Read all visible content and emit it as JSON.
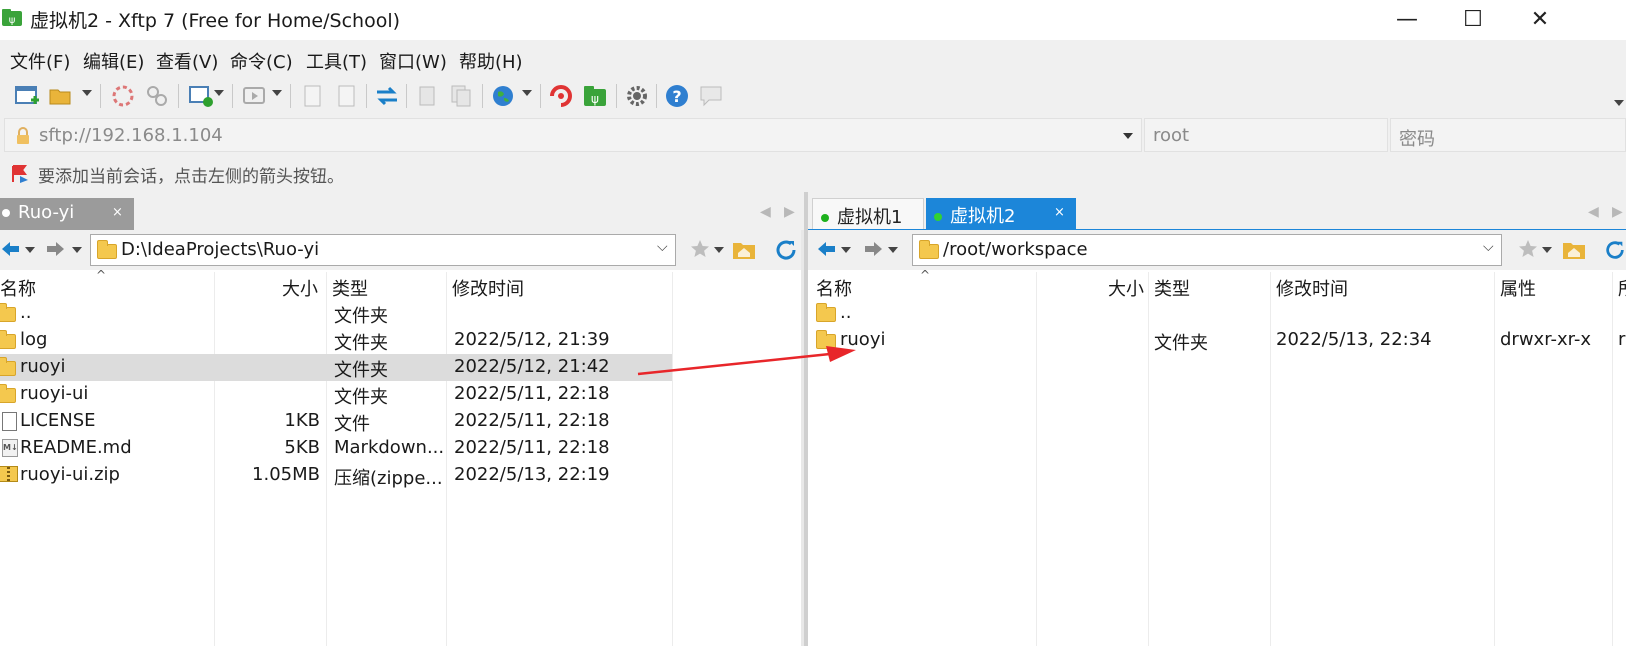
{
  "window": {
    "title": "虚拟机2 - Xftp 7 (Free for Home/School)",
    "minimize": "—",
    "maximize": "☐",
    "close": "✕"
  },
  "menu": [
    "文件(F)",
    "编辑(E)",
    "查看(V)",
    "命令(C)",
    "工具(T)",
    "窗口(W)",
    "帮助(H)"
  ],
  "toolbar": {
    "icons": [
      "new-session-icon",
      "open-folder-icon",
      "disconnect-icon",
      "link-icon",
      "new-window-icon",
      "play-icon",
      "copy-file-icon",
      "paste-file-icon",
      "transfer-icon",
      "copy-icon",
      "duplicate-icon",
      "globe-icon",
      "xshell-icon",
      "xftp-icon",
      "settings-icon",
      "help-icon",
      "chat-icon"
    ]
  },
  "address": {
    "url": "sftp://192.168.1.104",
    "user": "root",
    "password_placeholder": "密码"
  },
  "hint": "要添加当前会话，点击左侧的箭头按钮。",
  "left": {
    "tab": "Ruo-yi",
    "tab_close": "×",
    "path": "D:\\IdeaProjects\\Ruo-yi",
    "columns": [
      "名称",
      "大小",
      "类型",
      "修改时间"
    ],
    "rows": [
      {
        "name": "..",
        "size": "",
        "type": "文件夹",
        "modified": "",
        "icon": "folder-icon"
      },
      {
        "name": "log",
        "size": "",
        "type": "文件夹",
        "modified": "2022/5/12, 21:39",
        "icon": "folder-icon"
      },
      {
        "name": "ruoyi",
        "size": "",
        "type": "文件夹",
        "modified": "2022/5/12, 21:42",
        "icon": "folder-icon",
        "selected": true
      },
      {
        "name": "ruoyi-ui",
        "size": "",
        "type": "文件夹",
        "modified": "2022/5/11, 22:18",
        "icon": "folder-icon"
      },
      {
        "name": "LICENSE",
        "size": "1KB",
        "type": "文件",
        "modified": "2022/5/11, 22:18",
        "icon": "file-icon"
      },
      {
        "name": "README.md",
        "size": "5KB",
        "type": "Markdown...",
        "modified": "2022/5/11, 22:18",
        "icon": "markdown-icon"
      },
      {
        "name": "ruoyi-ui.zip",
        "size": "1.05MB",
        "type": "压缩(zippe...",
        "modified": "2022/5/13, 22:19",
        "icon": "zip-icon"
      }
    ]
  },
  "right": {
    "tabs": [
      {
        "label": "虚拟机1",
        "active": false,
        "dot_color": "#1db11d"
      },
      {
        "label": "虚拟机2",
        "active": true,
        "dot_color": "#32d232"
      }
    ],
    "tab_close": "×",
    "path": "/root/workspace",
    "columns": [
      "名称",
      "大小",
      "类型",
      "修改时间",
      "属性",
      "所"
    ],
    "rows": [
      {
        "name": "..",
        "size": "",
        "type": "",
        "modified": "",
        "attrs": "",
        "owner": "",
        "icon": "folder-icon"
      },
      {
        "name": "ruoyi",
        "size": "",
        "type": "文件夹",
        "modified": "2022/5/13, 22:34",
        "attrs": "drwxr-xr-x",
        "owner": "r",
        "icon": "folder-icon"
      }
    ]
  },
  "annotation": {
    "color": "#e8262a"
  },
  "colors": {
    "accent": "#1c86d9",
    "chrome": "#f0f0f0",
    "selection": "#dcdcdc"
  }
}
